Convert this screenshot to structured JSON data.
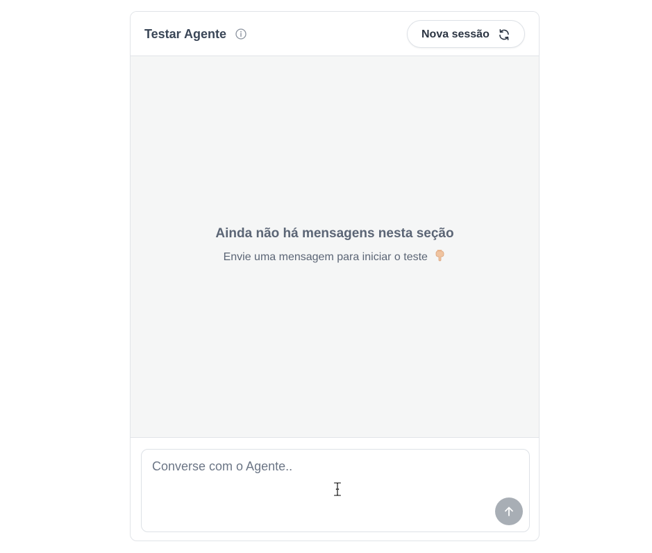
{
  "header": {
    "title": "Testar Agente",
    "new_session_label": "Nova sessão"
  },
  "empty_state": {
    "title": "Ainda não há mensagens nesta seção",
    "subtitle": "Envie uma mensagem para iniciar o teste"
  },
  "composer": {
    "placeholder": "Converse com o Agente..",
    "value": ""
  },
  "icons": {
    "info": "info-icon",
    "refresh": "refresh-icon",
    "hand": "hand-pointing-down-icon",
    "send": "arrow-up-icon"
  },
  "colors": {
    "panel_border": "#e1e4e8",
    "chat_background": "#f5f6f6",
    "send_button": "#a8aeb5",
    "title_text": "#3a4657",
    "muted_text": "#5b6575"
  }
}
